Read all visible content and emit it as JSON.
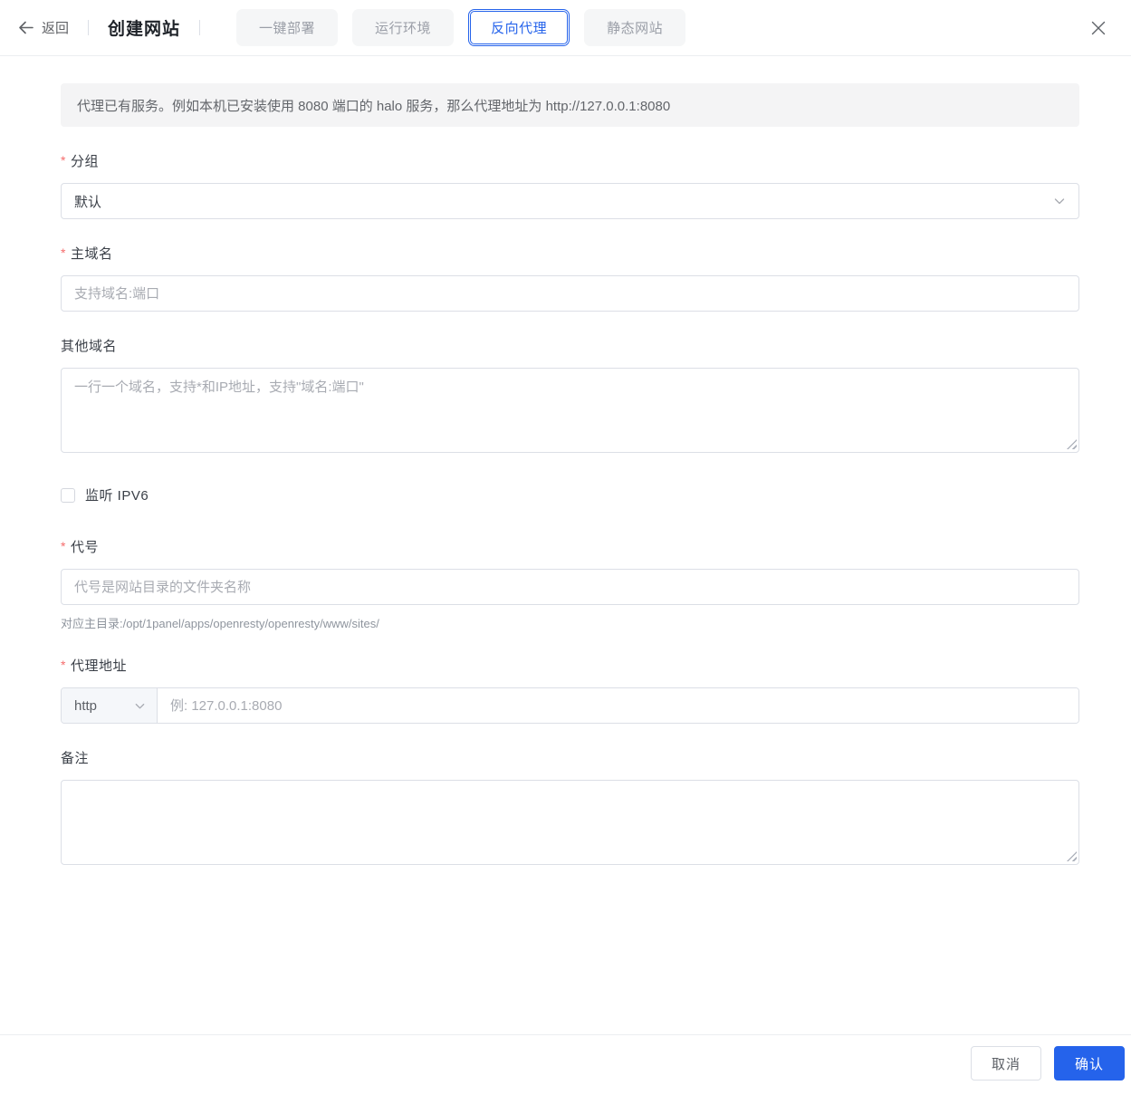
{
  "header": {
    "back_label": "返回",
    "title": "创建网站",
    "tabs": [
      {
        "label": "一键部署",
        "active": false
      },
      {
        "label": "运行环境",
        "active": false
      },
      {
        "label": "反向代理",
        "active": true
      },
      {
        "label": "静态网站",
        "active": false
      }
    ]
  },
  "banner": {
    "text": "代理已有服务。例如本机已安装使用 8080 端口的 halo 服务，那么代理地址为 http://127.0.0.1:8080"
  },
  "form": {
    "group": {
      "label": "分组",
      "required": true,
      "value": "默认"
    },
    "primary_domain": {
      "label": "主域名",
      "required": true,
      "placeholder": "支持域名:端口",
      "value": ""
    },
    "other_domains": {
      "label": "其他域名",
      "placeholder": "一行一个域名，支持*和IP地址，支持\"域名:端口\"",
      "value": ""
    },
    "ipv6": {
      "label": "监听 IPV6",
      "checked": false
    },
    "alias": {
      "label": "代号",
      "required": true,
      "placeholder": "代号是网站目录的文件夹名称",
      "value": "",
      "help": "对应主目录:/opt/1panel/apps/openresty/openresty/www/sites/"
    },
    "proxy_address": {
      "label": "代理地址",
      "required": true,
      "protocol": "http",
      "placeholder": "例: 127.0.0.1:8080",
      "value": ""
    },
    "remark": {
      "label": "备注",
      "value": ""
    }
  },
  "footer": {
    "cancel_label": "取消",
    "confirm_label": "确认"
  },
  "colors": {
    "primary": "#2563eb",
    "required": "#f56c6c"
  }
}
